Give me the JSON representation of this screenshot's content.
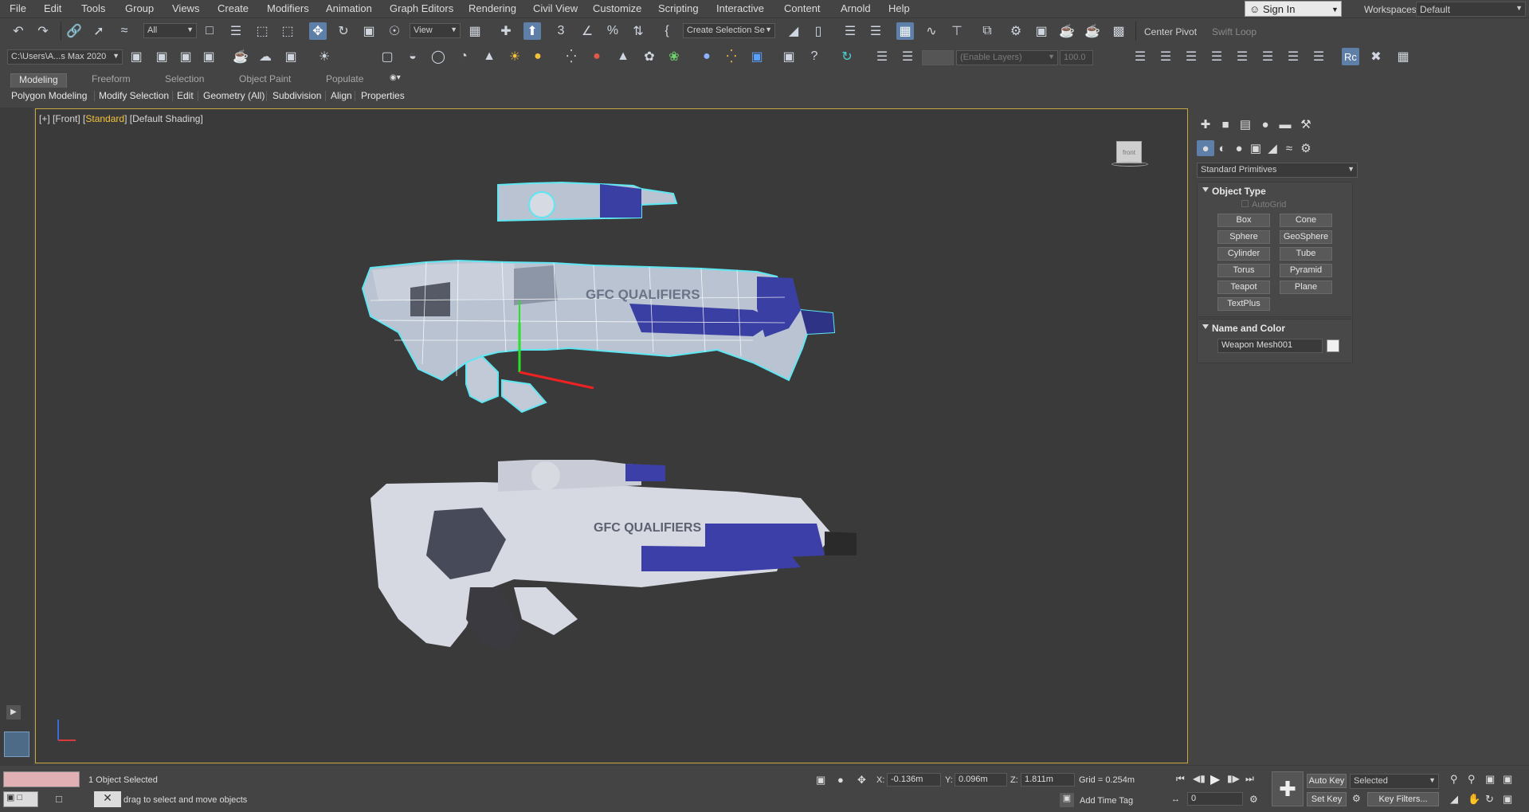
{
  "menu": [
    "File",
    "Edit",
    "Tools",
    "Group",
    "Views",
    "Create",
    "Modifiers",
    "Animation",
    "Graph Editors",
    "Rendering",
    "Civil View",
    "Customize",
    "Scripting",
    "Interactive",
    "Content",
    "Arnold",
    "Help"
  ],
  "sign_in": "Sign In",
  "workspaces": {
    "label": "Workspaces:",
    "value": "Default"
  },
  "toolbar1": {
    "filter": "All",
    "ref_coord": "View",
    "selection_set": "Create Selection Se",
    "center_pivot": "Center Pivot",
    "swift_loop": "Swift Loop"
  },
  "toolbar2": {
    "project_path": "C:\\Users\\A...s Max 2020",
    "layers_placeholder": "(Enable Layers)",
    "layer_value": "100.0"
  },
  "ribbon": {
    "tabs": [
      "Modeling",
      "Freeform",
      "Selection",
      "Object Paint",
      "Populate"
    ],
    "sub": [
      "Polygon Modeling",
      "Modify Selection",
      "Edit",
      "Geometry (All)",
      "Subdivision",
      "Align",
      "Properties"
    ]
  },
  "viewport": {
    "label_pre": "[+] [Front] [",
    "label_std": "Standard",
    "label_post": "] [Default Shading]",
    "viewcube": "front",
    "mesh_text": "GFC QUALIFIERS",
    "mesh_text_2": "GFC QUALIFIERS"
  },
  "cmdpanel": {
    "category": "Standard Primitives",
    "object_type_title": "Object Type",
    "autogrid": "AutoGrid",
    "buttons": [
      "Box",
      "Cone",
      "Sphere",
      "GeoSphere",
      "Cylinder",
      "Tube",
      "Torus",
      "Pyramid",
      "Teapot",
      "Plane",
      "TextPlus"
    ],
    "name_color_title": "Name and Color",
    "object_name": "Weapon Mesh001",
    "object_color": "#f0f0f0"
  },
  "status": {
    "selected": "1 Object Selected",
    "prompt": "drag to select and move objects",
    "x_label": "X:",
    "x": "-0.136m",
    "y_label": "Y:",
    "y": "0.096m",
    "z_label": "Z:",
    "z": "1.811m",
    "grid": "Grid = 0.254m",
    "add_time_tag": "Add Time Tag",
    "auto_key": "Auto Key",
    "set_key": "Set Key",
    "key_mode": "Selected",
    "key_filters": "Key Filters...",
    "frame": "0"
  },
  "colors": {
    "accent_selection": "#f2c23d",
    "wire": "#5ee6f2",
    "active_tool": "#5d7fa8"
  }
}
